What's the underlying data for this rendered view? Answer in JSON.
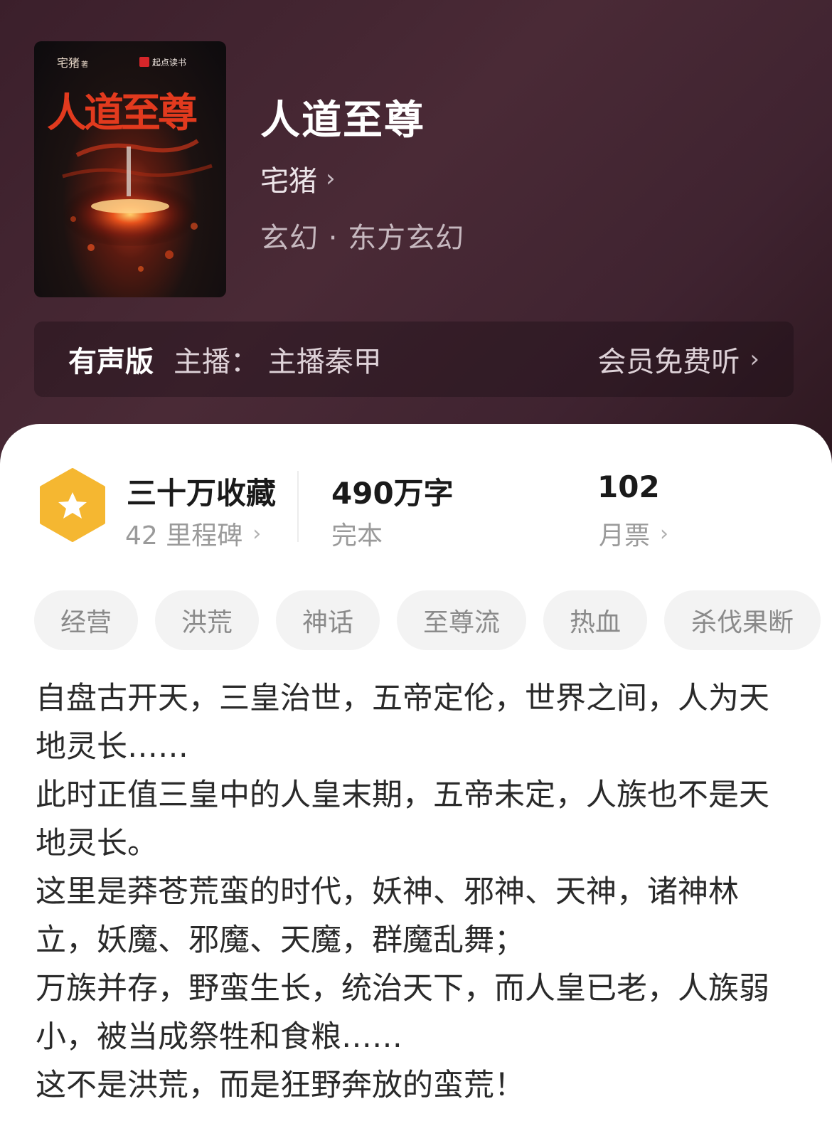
{
  "book": {
    "title": "人道至尊",
    "author": "宅猪",
    "genre": "玄幻 · 东方玄幻",
    "cover": {
      "author_text": "宅猪",
      "author_suffix": "著",
      "publisher": "起点读书",
      "title_text": "人道至尊"
    }
  },
  "audio": {
    "label": "有声版",
    "narrator": "主播：  主播秦甲",
    "action": "会员免费听"
  },
  "stats": {
    "favorites": "三十万收藏",
    "milestones": "42 里程碑",
    "word_count": "490万字",
    "status": "完本",
    "monthly_votes": "102",
    "monthly_votes_label": "月票"
  },
  "tags": [
    "经营",
    "洪荒",
    "神话",
    "至尊流",
    "热血",
    "杀伐果断"
  ],
  "synopsis": [
    "自盘古开天，三皇治世，五帝定伦，世界之间，人为天地灵长……",
    "此时正值三皇中的人皇末期，五帝未定，人族也不是天地灵长。",
    "这里是莽苍荒蛮的时代，妖神、邪神、天神，诸神林立，妖魔、邪魔、天魔，群魔乱舞；",
    "万族并存，野蛮生长，统治天下，而人皇已老，人族弱小，被当成祭牲和食粮……",
    "这不是洪荒，而是狂野奔放的蛮荒！"
  ],
  "colors": {
    "header_bg": "#3b1f2b",
    "badge": "#f5b731",
    "tag_bg": "#f3f3f3"
  }
}
